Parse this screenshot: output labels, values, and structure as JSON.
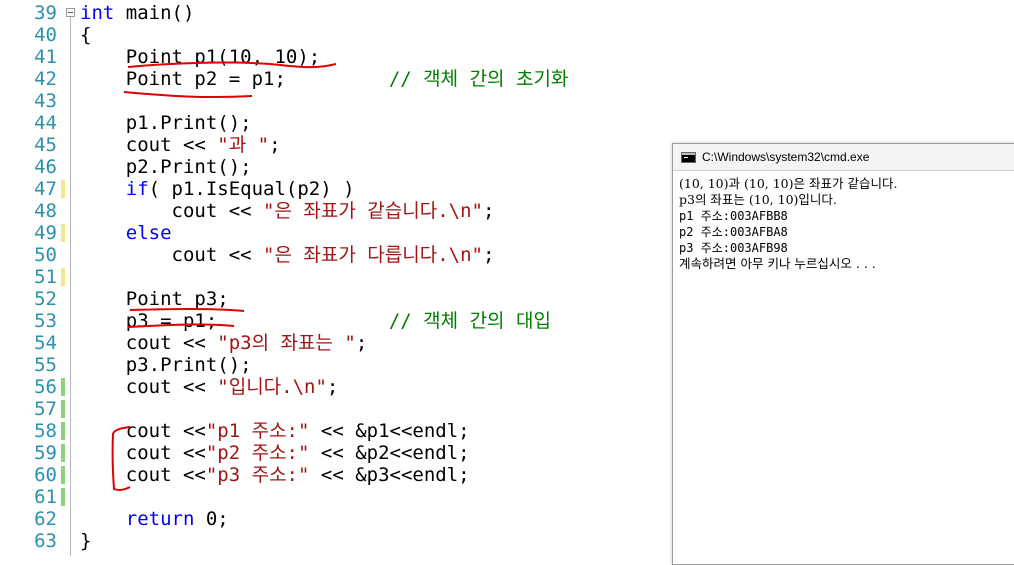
{
  "editor": {
    "lines": [
      {
        "num": "39",
        "mark": "",
        "fold": true,
        "tokens": [
          {
            "t": "kw",
            "v": "int"
          },
          {
            "t": "tx",
            "v": " main()"
          }
        ]
      },
      {
        "num": "40",
        "mark": "",
        "tokens": [
          {
            "t": "tx",
            "v": "{"
          }
        ]
      },
      {
        "num": "41",
        "mark": "",
        "tokens": [
          {
            "t": "tx",
            "v": "    Point p1(10, 10);"
          }
        ]
      },
      {
        "num": "42",
        "mark": "",
        "tokens": [
          {
            "t": "tx",
            "v": "    Point p2 = p1;         "
          },
          {
            "t": "cm",
            "v": "// 객체 간의 초기화"
          }
        ]
      },
      {
        "num": "43",
        "mark": "",
        "tokens": []
      },
      {
        "num": "44",
        "mark": "",
        "tokens": [
          {
            "t": "tx",
            "v": "    p1.Print();"
          }
        ]
      },
      {
        "num": "45",
        "mark": "",
        "tokens": [
          {
            "t": "tx",
            "v": "    cout << "
          },
          {
            "t": "str",
            "v": "\"과 \""
          },
          {
            "t": "tx",
            "v": ";"
          }
        ]
      },
      {
        "num": "46",
        "mark": "",
        "tokens": [
          {
            "t": "tx",
            "v": "    p2.Print();"
          }
        ]
      },
      {
        "num": "47",
        "mark": "y",
        "tokens": [
          {
            "t": "tx",
            "v": "    "
          },
          {
            "t": "kw",
            "v": "if"
          },
          {
            "t": "tx",
            "v": "( p1.IsEqual(p2) )"
          }
        ]
      },
      {
        "num": "48",
        "mark": "",
        "tokens": [
          {
            "t": "tx",
            "v": "        cout << "
          },
          {
            "t": "str",
            "v": "\"은 좌표가 같습니다.\\n\""
          },
          {
            "t": "tx",
            "v": ";"
          }
        ]
      },
      {
        "num": "49",
        "mark": "y",
        "tokens": [
          {
            "t": "tx",
            "v": "    "
          },
          {
            "t": "kw",
            "v": "else"
          }
        ]
      },
      {
        "num": "50",
        "mark": "",
        "tokens": [
          {
            "t": "tx",
            "v": "        cout << "
          },
          {
            "t": "str",
            "v": "\"은 좌표가 다릅니다.\\n\""
          },
          {
            "t": "tx",
            "v": ";"
          }
        ]
      },
      {
        "num": "51",
        "mark": "y",
        "tokens": []
      },
      {
        "num": "52",
        "mark": "",
        "tokens": [
          {
            "t": "tx",
            "v": "    Point p3;"
          }
        ]
      },
      {
        "num": "53",
        "mark": "",
        "tokens": [
          {
            "t": "tx",
            "v": "    p3 = p1;               "
          },
          {
            "t": "cm",
            "v": "// 객체 간의 대입"
          }
        ]
      },
      {
        "num": "54",
        "mark": "",
        "tokens": [
          {
            "t": "tx",
            "v": "    cout << "
          },
          {
            "t": "str",
            "v": "\"p3의 좌표는 \""
          },
          {
            "t": "tx",
            "v": ";"
          }
        ]
      },
      {
        "num": "55",
        "mark": "",
        "tokens": [
          {
            "t": "tx",
            "v": "    p3.Print();"
          }
        ]
      },
      {
        "num": "56",
        "mark": "g",
        "tokens": [
          {
            "t": "tx",
            "v": "    cout << "
          },
          {
            "t": "str",
            "v": "\"입니다.\\n\""
          },
          {
            "t": "tx",
            "v": ";"
          }
        ]
      },
      {
        "num": "57",
        "mark": "g",
        "tokens": []
      },
      {
        "num": "58",
        "mark": "g",
        "tokens": [
          {
            "t": "tx",
            "v": "    cout <<"
          },
          {
            "t": "str",
            "v": "\"p1 주소:\""
          },
          {
            "t": "tx",
            "v": " << &p1<<endl;"
          }
        ]
      },
      {
        "num": "59",
        "mark": "g",
        "tokens": [
          {
            "t": "tx",
            "v": "    cout <<"
          },
          {
            "t": "str",
            "v": "\"p2 주소:\""
          },
          {
            "t": "tx",
            "v": " << &p2<<endl;"
          }
        ]
      },
      {
        "num": "60",
        "mark": "g",
        "tokens": [
          {
            "t": "tx",
            "v": "    cout <<"
          },
          {
            "t": "str",
            "v": "\"p3 주소:\""
          },
          {
            "t": "tx",
            "v": " << &p3<<endl;"
          }
        ]
      },
      {
        "num": "61",
        "mark": "g",
        "tokens": []
      },
      {
        "num": "62",
        "mark": "",
        "tokens": [
          {
            "t": "tx",
            "v": "    "
          },
          {
            "t": "kw",
            "v": "return"
          },
          {
            "t": "tx",
            "v": " 0;"
          }
        ]
      },
      {
        "num": "63",
        "mark": "",
        "tokens": [
          {
            "t": "tx",
            "v": "}"
          }
        ]
      }
    ]
  },
  "console": {
    "title": "C:\\Windows\\system32\\cmd.exe",
    "lines": [
      "(10, 10)과 (10, 10)은 좌표가 같습니다.",
      "p3의 좌표는 (10, 10)입니다.",
      "p1 주소:003AFBB8",
      "p2 주소:003AFBA8",
      "p3 주소:003AFB98",
      "계속하려면 아무 키나 누르십시오 . . ."
    ]
  },
  "colors": {
    "keyword": "#0000ff",
    "string": "#a31515",
    "comment": "#008000",
    "line_number": "#2b91af",
    "change_mark_unsaved": "#f4e68c",
    "change_mark_saved": "#8fd27b",
    "annotation_ink": "#e00000"
  }
}
